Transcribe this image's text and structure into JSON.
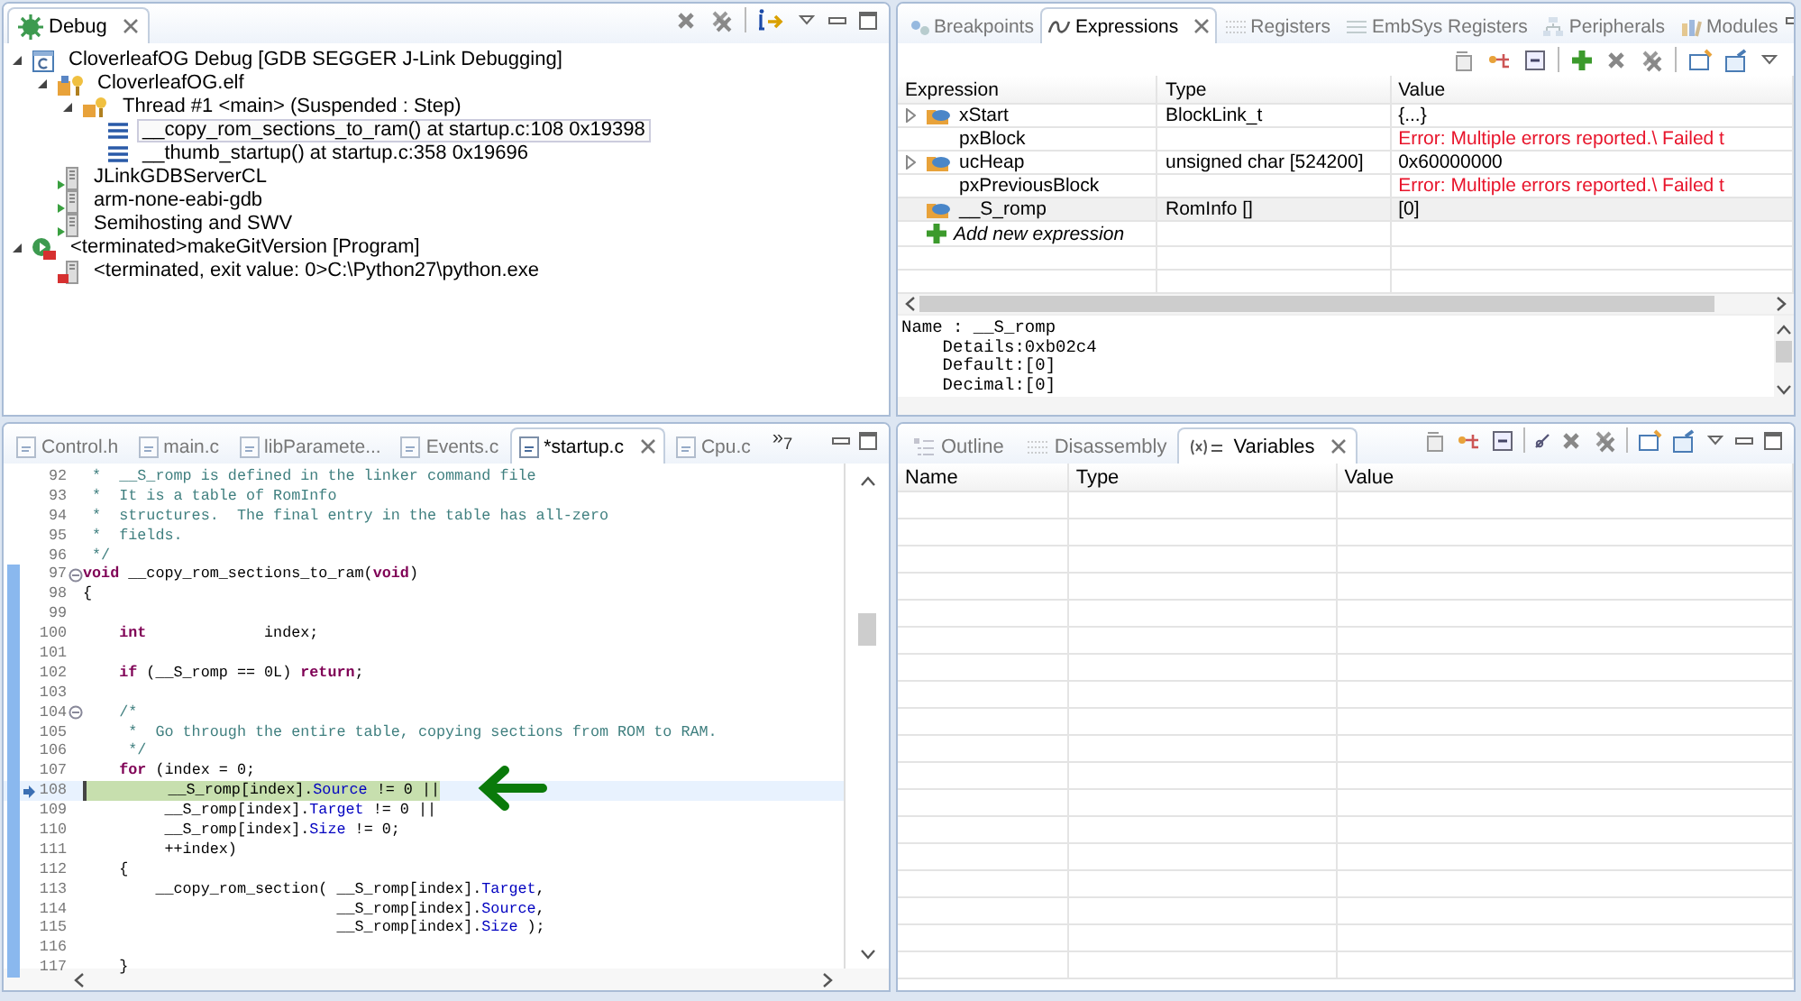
{
  "debug_view": {
    "tabs": [
      {
        "label": "Debug",
        "selected": true
      }
    ],
    "tree": [
      {
        "label": "CloverleafOG Debug [GDB SEGGER J-Link Debugging]",
        "kind": "launch",
        "expanded": true,
        "selected": false,
        "children": [
          {
            "label": "CloverleafOG.elf",
            "kind": "process",
            "expanded": true,
            "selected": false,
            "children": [
              {
                "label": "Thread #1 <main> (Suspended : Step)",
                "kind": "thread",
                "expanded": true,
                "selected": false,
                "children": [
                  {
                    "label": "__copy_rom_sections_to_ram() at startup.c:108 0x19398",
                    "kind": "frame",
                    "selected": true
                  },
                  {
                    "label": "__thumb_startup() at startup.c:358 0x19696",
                    "kind": "frame",
                    "selected": false
                  }
                ]
              }
            ]
          },
          {
            "label": "JLinkGDBServerCL",
            "kind": "app",
            "selected": false
          },
          {
            "label": "arm-none-eabi-gdb",
            "kind": "app",
            "selected": false
          },
          {
            "label": "Semihosting and SWV",
            "kind": "app",
            "selected": false
          }
        ]
      },
      {
        "label": "<terminated>makeGitVersion [Program]",
        "kind": "terminated-launch",
        "expanded": true,
        "selected": false,
        "children": [
          {
            "label": "<terminated, exit value: 0>C:\\Python27\\python.exe",
            "kind": "terminated-app",
            "selected": false
          }
        ]
      }
    ]
  },
  "expressions_view": {
    "tabs": [
      {
        "label": "Breakpoints",
        "selected": false
      },
      {
        "label": "Expressions",
        "selected": true
      },
      {
        "label": "Registers",
        "selected": false
      },
      {
        "label": "EmbSys Registers",
        "selected": false
      },
      {
        "label": "Peripherals",
        "selected": false
      },
      {
        "label": "Modules",
        "selected": false
      }
    ],
    "columns": [
      "Expression",
      "Type",
      "Value"
    ],
    "rows": [
      {
        "name": "xStart",
        "type": "BlockLink_t",
        "value": "{...}",
        "kind": "variable",
        "expandable": true,
        "selected": false
      },
      {
        "name": "pxBlock",
        "value": "Error: Multiple errors reported.\\ Failed t",
        "kind": "failed",
        "expandable": false,
        "selected": false
      },
      {
        "name": "ucHeap",
        "type": "unsigned char [524200]",
        "value": "0x60000000",
        "kind": "variable",
        "expandable": true,
        "selected": false
      },
      {
        "name": "pxPreviousBlock",
        "value": "Error: Multiple errors reported.\\ Failed t",
        "kind": "failed",
        "expandable": false,
        "selected": false
      },
      {
        "name": "__S_romp",
        "type": "RomInfo []",
        "value": "[0]",
        "kind": "variable",
        "expandable": false,
        "selected": true
      }
    ],
    "add_expression": "Add new expression",
    "details": "Name : __S_romp\n    Details:0xb02c4\n    Default:[0]\n    Decimal:[0]"
  },
  "editor": {
    "tabs": [
      {
        "label": "Control.h",
        "selected": false
      },
      {
        "label": "main.c",
        "selected": false
      },
      {
        "label": "libParamete...",
        "selected": false
      },
      {
        "label": "Events.c",
        "selected": false
      },
      {
        "label": "*startup.c",
        "selected": true
      },
      {
        "label": "Cpu.c",
        "selected": false
      }
    ],
    "overflow": "»$_{7}$",
    "lines": [
      {
        "number": "92",
        "modified": false,
        "current": false,
        "tokens": [
          {
            "kind": "comment",
            "text": " *  __S_romp is defined in the linker command file"
          }
        ]
      },
      {
        "number": "93",
        "modified": false,
        "current": false,
        "tokens": [
          {
            "kind": "comment",
            "text": " *  It is a table of RomInfo"
          }
        ]
      },
      {
        "number": "94",
        "modified": false,
        "current": false,
        "tokens": [
          {
            "kind": "comment",
            "text": " *  structures.  The final entry in the table has all-zero"
          }
        ]
      },
      {
        "number": "95",
        "modified": false,
        "current": false,
        "tokens": [
          {
            "kind": "comment",
            "text": " *  fields."
          }
        ]
      },
      {
        "number": "96",
        "modified": false,
        "current": false,
        "tokens": [
          {
            "kind": "comment",
            "text": " */"
          }
        ]
      },
      {
        "number": "97",
        "modified": true,
        "current": false,
        "fold": true,
        "tokens": [
          {
            "kind": "keyword",
            "text": "void"
          },
          {
            "kind": "plain",
            "text": " __copy_rom_sections_to_ram("
          },
          {
            "kind": "keyword",
            "text": "void"
          },
          {
            "kind": "plain",
            "text": ")"
          }
        ]
      },
      {
        "number": "98",
        "modified": true,
        "current": false,
        "tokens": [
          {
            "kind": "plain",
            "text": "{"
          }
        ]
      },
      {
        "number": "99",
        "modified": true,
        "current": false
      },
      {
        "number": "100",
        "modified": true,
        "current": false,
        "tokens": [
          {
            "kind": "keyword",
            "text": "    int"
          },
          {
            "kind": "plain",
            "text": "             index;"
          }
        ]
      },
      {
        "number": "101",
        "modified": true,
        "current": false
      },
      {
        "number": "102",
        "modified": true,
        "current": false,
        "tokens": [
          {
            "kind": "keyword",
            "text": "    if"
          },
          {
            "kind": "plain",
            "text": " (__S_romp == 0L) "
          },
          {
            "kind": "keyword",
            "text": "return"
          },
          {
            "kind": "plain",
            "text": ";"
          }
        ]
      },
      {
        "number": "103",
        "modified": true,
        "current": false
      },
      {
        "number": "104",
        "modified": true,
        "current": false,
        "fold": true,
        "tokens": [
          {
            "kind": "comment",
            "text": "    /*"
          }
        ]
      },
      {
        "number": "105",
        "modified": true,
        "current": false,
        "tokens": [
          {
            "kind": "comment",
            "text": "     *  Go through the entire table, copying sections from ROM to RAM."
          }
        ]
      },
      {
        "number": "106",
        "modified": true,
        "current": false,
        "tokens": [
          {
            "kind": "comment",
            "text": "     */"
          }
        ]
      },
      {
        "number": "107",
        "modified": true,
        "current": false,
        "tokens": [
          {
            "kind": "keyword",
            "text": "    for"
          },
          {
            "kind": "plain",
            "text": " (index = 0;"
          }
        ]
      },
      {
        "number": "108",
        "modified": true,
        "current": true,
        "tokens": [
          {
            "kind": "plain",
            "text": "         __S_romp[index]."
          },
          {
            "kind": "field",
            "text": "Source"
          },
          {
            "kind": "plain",
            "text": " != 0 ||"
          }
        ]
      },
      {
        "number": "109",
        "modified": true,
        "current": false,
        "tokens": [
          {
            "kind": "plain",
            "text": "         __S_romp[index]."
          },
          {
            "kind": "field",
            "text": "Target"
          },
          {
            "kind": "plain",
            "text": " != 0 ||"
          }
        ]
      },
      {
        "number": "110",
        "modified": true,
        "current": false,
        "tokens": [
          {
            "kind": "plain",
            "text": "         __S_romp[index]."
          },
          {
            "kind": "field",
            "text": "Size"
          },
          {
            "kind": "plain",
            "text": " != 0;"
          }
        ]
      },
      {
        "number": "111",
        "modified": true,
        "current": false,
        "tokens": [
          {
            "kind": "plain",
            "text": "         ++index)"
          }
        ]
      },
      {
        "number": "112",
        "modified": true,
        "current": false,
        "tokens": [
          {
            "kind": "plain",
            "text": "    {"
          }
        ]
      },
      {
        "number": "113",
        "modified": true,
        "current": false,
        "tokens": [
          {
            "kind": "plain",
            "text": "        __copy_rom_section( __S_romp[index]."
          },
          {
            "kind": "field",
            "text": "Target"
          },
          {
            "kind": "plain",
            "text": ","
          }
        ]
      },
      {
        "number": "114",
        "modified": true,
        "current": false,
        "tokens": [
          {
            "kind": "plain",
            "text": "                            __S_romp[index]."
          },
          {
            "kind": "field",
            "text": "Source"
          },
          {
            "kind": "plain",
            "text": ","
          }
        ]
      },
      {
        "number": "115",
        "modified": true,
        "current": false,
        "tokens": [
          {
            "kind": "plain",
            "text": "                            __S_romp[index]."
          },
          {
            "kind": "field",
            "text": "Size"
          },
          {
            "kind": "plain",
            "text": " );"
          }
        ]
      },
      {
        "number": "116",
        "modified": true,
        "current": false
      },
      {
        "number": "117",
        "modified": true,
        "current": false,
        "tokens": [
          {
            "kind": "plain",
            "text": "    }"
          }
        ]
      }
    ]
  },
  "variables_view": {
    "tabs": [
      {
        "label": "Outline",
        "selected": false
      },
      {
        "label": "Disassembly",
        "selected": false
      },
      {
        "label": "Variables",
        "selected": true
      }
    ],
    "columns": [
      "Name",
      "Type",
      "Value"
    ]
  }
}
